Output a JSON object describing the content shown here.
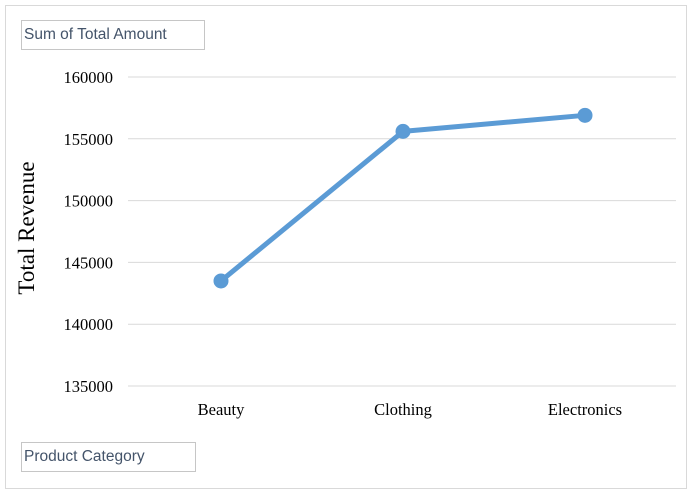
{
  "pivot": {
    "value_field_label": "Sum of Total Amount",
    "axis_field_label": "Product Category"
  },
  "colors": {
    "line": "#5b9bd5",
    "grid": "#d9d9d9",
    "field_text": "#44546a"
  },
  "chart_data": {
    "type": "line",
    "title": "",
    "xlabel": "",
    "ylabel": "Total Revenue",
    "categories": [
      "Beauty",
      "Clothing",
      "Electronics"
    ],
    "series": [
      {
        "values": [
          143500,
          155600,
          156900
        ]
      }
    ],
    "ylim": [
      135000,
      160000
    ],
    "y_ticks": [
      135000,
      140000,
      145000,
      150000,
      155000,
      160000
    ],
    "grid": true,
    "markers": true
  }
}
